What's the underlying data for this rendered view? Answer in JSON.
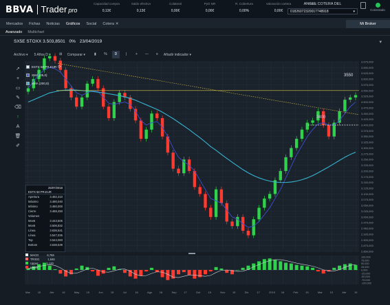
{
  "header": {
    "brand": "BBVA",
    "app": "Trader",
    "app_suffix": "pro",
    "stats": [
      {
        "label": "Capacidad compra",
        "value": "0,13€"
      },
      {
        "label": "Saldo efectivo",
        "value": "0,13€"
      },
      {
        "label": "Colateral",
        "value": "0,00€"
      },
      {
        "label": "PyG NR",
        "value": "0,00€"
      },
      {
        "label": "R. Cobertura",
        "value": "0,00%"
      },
      {
        "label": "Valoración cartera",
        "value": "0,00€"
      },
      {
        "label": "Perfil",
        "value": "P0"
      }
    ],
    "user_name": "ANGEL COTERA DEL",
    "account": "01826072320017748918",
    "status": "Conectado"
  },
  "nav": {
    "items": [
      "Mercados",
      "Fichas",
      "Noticias",
      "Gráficos",
      "Social",
      "Cotera"
    ],
    "active": "Gráficos",
    "close_glyph": "✕",
    "mibroker": "Mi Broker"
  },
  "subnav": {
    "items": [
      "Avanzado",
      "Multichart"
    ],
    "active": "Avanzado"
  },
  "chart_header": {
    "symbol": "SX5E STOXX",
    "price": "3.503,8501",
    "change": "0%",
    "date": "23/04/2019"
  },
  "toolbar": {
    "archivo": "Archivo ▾",
    "period": "5 Años D ▾",
    "comparar": "Comparar ▾",
    "pct": "%",
    "d": "D",
    "add_indicator": "Añadir indicador ▾"
  },
  "tools": [
    "pointer",
    "crosshair",
    "rectangle",
    "pencil",
    "eraser-line",
    "arrow-up",
    "text",
    "trash",
    "edit"
  ],
  "legend": [
    {
      "label": "ESTX 50 PR.EUR",
      "color": "#e8f0f8"
    },
    {
      "label": "SMA (35,0)",
      "color": "#4a5cd0"
    },
    {
      "label": "SMA (200,0)",
      "color": "#37b6d2"
    }
  ],
  "data_window": {
    "date": "25/07/2018",
    "title": "ESTX 50 PR.EUR",
    "rows": [
      {
        "k": "Apertura",
        "v": "3.482,310"
      },
      {
        "k": "Máximo",
        "v": "3.490,040"
      },
      {
        "k": "Mínimo",
        "v": "3.460,000"
      },
      {
        "k": "Cierre",
        "v": "3.468,450"
      },
      {
        "k": "Volumen",
        "v": ""
      },
      {
        "k": "Mov5",
        "v": "3.443,505"
      },
      {
        "k": "Mov5",
        "v": "3.506,832"
      },
      {
        "k": "Línea",
        "v": "3.636,541"
      },
      {
        "k": "Línea",
        "v": "3.547,035"
      },
      {
        "k": "Top",
        "v": "3.544,083"
      },
      {
        "k": "Bottom",
        "v": "3.538,539"
      }
    ]
  },
  "indicator_legend": [
    {
      "k": "MACD",
      "v": "6,765",
      "color": "#e8f0f8"
    },
    {
      "k": "TRIGG",
      "v": "1,646",
      "color": "#ff6a6a"
    },
    {
      "k": "Upper",
      "v": "5,120",
      "color": "#3ad24a"
    },
    {
      "k": "Lower",
      "v": "",
      "color": "#ff3a3a"
    }
  ],
  "annotations": {
    "level_high": "3550",
    "level_low": "3400"
  },
  "chart_data": {
    "type": "candlestick",
    "series": [
      {
        "name": "ESTX 50 PR.EUR",
        "close": [
          3560,
          3600,
          3640,
          3690,
          3700,
          3680,
          3640,
          3560,
          3520,
          3480,
          3520,
          3580,
          3600,
          3560,
          3480,
          3430,
          3500,
          3540,
          3520,
          3470,
          3420,
          3340,
          3380,
          3450,
          3430,
          3350,
          3280,
          3210,
          3190,
          3250,
          3200,
          3130,
          3100,
          3040,
          3000,
          3120,
          3060,
          2980,
          2960,
          3000,
          2940,
          2920,
          2990,
          3040,
          3080,
          3100,
          3160,
          3200,
          3260,
          3300,
          3340,
          3380,
          3410,
          3420,
          3460,
          3400,
          3350,
          3410,
          3460,
          3510,
          3520,
          3530
        ]
      },
      {
        "name": "SMA (35,0)",
        "values": [
          3560,
          3590,
          3620,
          3640,
          3650,
          3645,
          3630,
          3600,
          3570,
          3540,
          3530,
          3540,
          3550,
          3545,
          3520,
          3495,
          3490,
          3495,
          3500,
          3490,
          3460,
          3420,
          3400,
          3410,
          3415,
          3390,
          3350,
          3300,
          3260,
          3240,
          3225,
          3200,
          3160,
          3120,
          3080,
          3070,
          3060,
          3030,
          3000,
          2990,
          2970,
          2955,
          2960,
          2980,
          3010,
          3040,
          3080,
          3120,
          3170,
          3220,
          3270,
          3310,
          3350,
          3380,
          3405,
          3410,
          3400,
          3400,
          3420,
          3450,
          3480,
          3500
        ]
      },
      {
        "name": "SMA (200,0)",
        "values": [
          3500,
          3510,
          3520,
          3530,
          3540,
          3545,
          3550,
          3552,
          3553,
          3552,
          3550,
          3548,
          3546,
          3543,
          3540,
          3536,
          3532,
          3528,
          3522,
          3516,
          3508,
          3498,
          3488,
          3478,
          3468,
          3456,
          3442,
          3428,
          3412,
          3396,
          3380,
          3362,
          3345,
          3326,
          3306,
          3290,
          3272,
          3255,
          3238,
          3222,
          3206,
          3192,
          3180,
          3170,
          3162,
          3156,
          3152,
          3150,
          3150,
          3152,
          3156,
          3162,
          3170,
          3180,
          3192,
          3205,
          3218,
          3232,
          3246,
          3260,
          3272,
          3282
        ]
      }
    ],
    "x_tick_labels": [
      "Mar",
      "15",
      "Abr",
      "16",
      "May",
      "15",
      "Jun",
      "15",
      "Jul",
      "16",
      "Ago",
      "16",
      "Sep",
      "17",
      "Oct",
      "15",
      "Nov",
      "15",
      "Dic",
      "17",
      "2019",
      "16",
      "Feb",
      "15",
      "Mar",
      "15",
      "Abr",
      "15"
    ],
    "y_tick_labels": [
      "3.675,000",
      "3.650,000",
      "3.625,000",
      "3.600,000",
      "3.575,000",
      "3.550,000",
      "3.525,000",
      "3.500,000",
      "3.475,000",
      "3.450,000",
      "3.425,000",
      "3.400,000",
      "3.375,000",
      "3.350,000",
      "3.325,000",
      "3.300,000",
      "3.275,000",
      "3.250,000",
      "3.225,000",
      "3.200,000",
      "3.175,000",
      "3.150,000",
      "3.125,000",
      "3.100,000",
      "3.075,000",
      "3.050,000",
      "3.025,000",
      "3.000,000",
      "2.975,000",
      "2.950,000",
      "2.925,000",
      "2.900,000",
      "2.875,000",
      "2.850,000"
    ],
    "y_range": [
      2850,
      3675
    ],
    "horizontal_levels": [
      3550,
      3400
    ],
    "indicator": {
      "name": "MACD",
      "histogram": [
        2,
        5,
        8,
        10,
        6,
        1,
        -5,
        -9,
        -6,
        2,
        6,
        4,
        -2,
        -8,
        -5,
        3,
        5,
        1,
        -4,
        -9,
        -12,
        -8,
        -2,
        3,
        -3,
        -10,
        -14,
        -12,
        -6,
        -3,
        -7,
        -12,
        -10,
        -6,
        -2,
        4,
        2,
        -4,
        -6,
        0,
        3,
        6,
        9,
        12,
        15,
        16,
        14,
        12,
        10,
        9,
        7,
        6,
        5,
        3,
        -2,
        -5,
        -2,
        3,
        6,
        8,
        9,
        7
      ],
      "y_tick_labels": [
        "100,000",
        "75,000",
        "50,000",
        "25,000",
        "0,000",
        "-25,000",
        "-50,000",
        "-75,000",
        "-100,000"
      ]
    },
    "grid": true
  }
}
